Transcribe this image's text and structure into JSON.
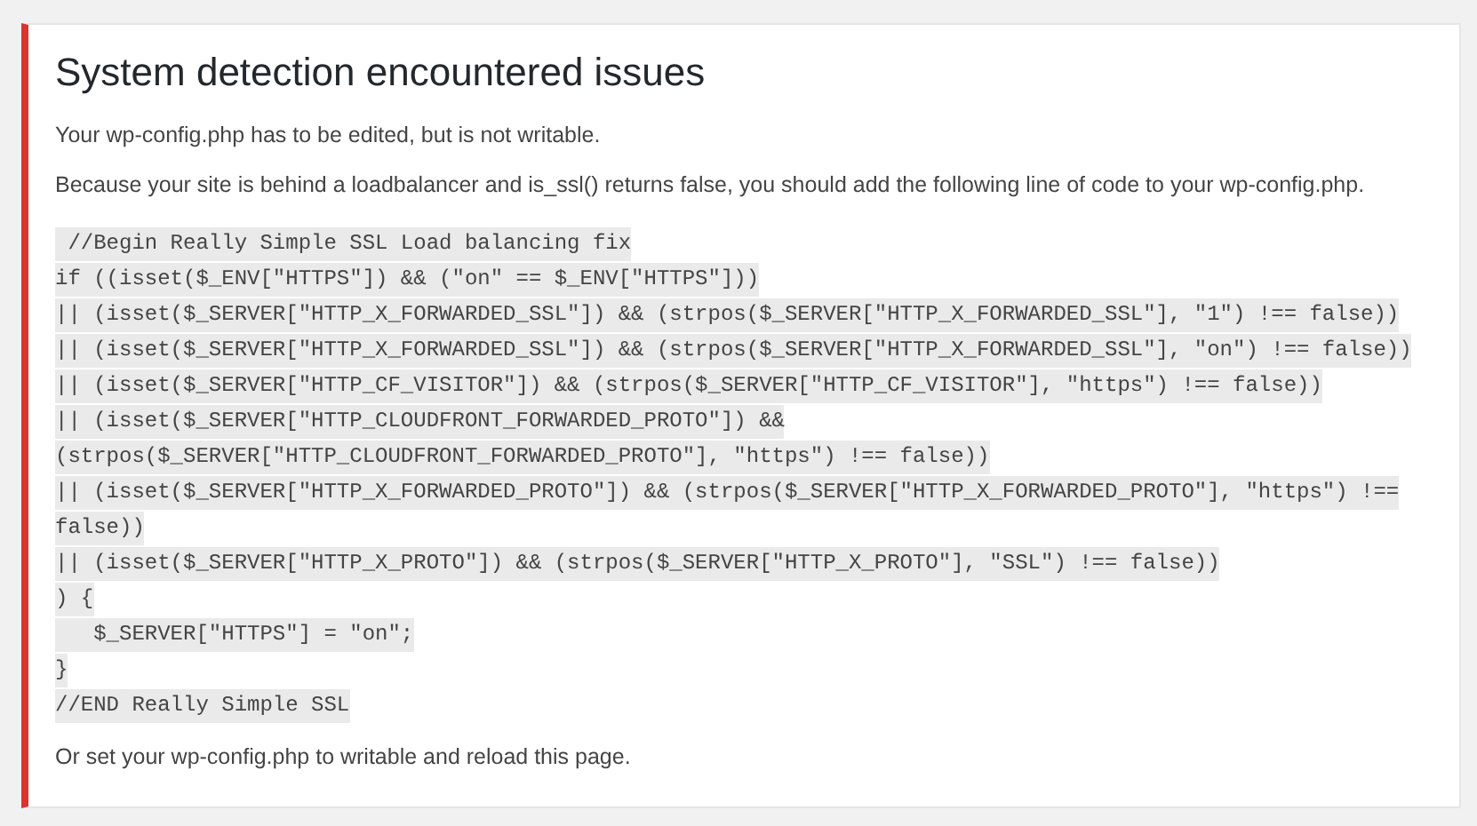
{
  "notice": {
    "title": "System detection encountered issues",
    "paragraphs": [
      "Your wp-config.php has to be edited, but is not writable.",
      "Because your site is behind a loadbalancer and is_ssl() returns false, you should add the following line of code to your wp-config.php."
    ],
    "code_lines": [
      " //Begin Really Simple SSL Load balancing fix",
      "if ((isset($_ENV[\"HTTPS\"]) && (\"on\" == $_ENV[\"HTTPS\"]))",
      "|| (isset($_SERVER[\"HTTP_X_FORWARDED_SSL\"]) && (strpos($_SERVER[\"HTTP_X_FORWARDED_SSL\"], \"1\") !== false))",
      "|| (isset($_SERVER[\"HTTP_X_FORWARDED_SSL\"]) && (strpos($_SERVER[\"HTTP_X_FORWARDED_SSL\"], \"on\") !== false))",
      "|| (isset($_SERVER[\"HTTP_CF_VISITOR\"]) && (strpos($_SERVER[\"HTTP_CF_VISITOR\"], \"https\") !== false))",
      "|| (isset($_SERVER[\"HTTP_CLOUDFRONT_FORWARDED_PROTO\"]) &&",
      "(strpos($_SERVER[\"HTTP_CLOUDFRONT_FORWARDED_PROTO\"], \"https\") !== false))",
      "|| (isset($_SERVER[\"HTTP_X_FORWARDED_PROTO\"]) && (strpos($_SERVER[\"HTTP_X_FORWARDED_PROTO\"], \"https\") !==",
      "false))",
      "|| (isset($_SERVER[\"HTTP_X_PROTO\"]) && (strpos($_SERVER[\"HTTP_X_PROTO\"], \"SSL\") !== false))",
      ") {",
      "   $_SERVER[\"HTTPS\"] = \"on\";",
      "}",
      "//END Really Simple SSL"
    ],
    "footer": "Or set your wp-config.php to writable and reload this page."
  }
}
